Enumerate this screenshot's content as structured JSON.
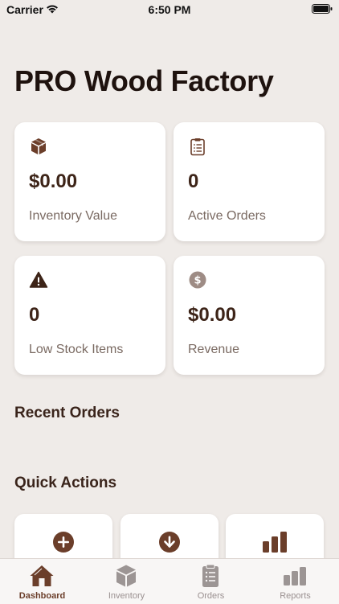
{
  "status_bar": {
    "carrier": "Carrier",
    "time": "6:50 PM"
  },
  "page": {
    "title": "PRO Wood Factory"
  },
  "stats": [
    {
      "icon": "box-icon",
      "value": "$0.00",
      "label": "Inventory Value"
    },
    {
      "icon": "clipboard-icon",
      "value": "0",
      "label": "Active Orders"
    },
    {
      "icon": "warning-icon",
      "value": "0",
      "label": "Low Stock Items"
    },
    {
      "icon": "dollar-icon",
      "value": "$0.00",
      "label": "Revenue"
    }
  ],
  "sections": {
    "recent_orders": "Recent Orders",
    "quick_actions": "Quick Actions"
  },
  "quick_actions": [
    {
      "icon": "add-circle-icon"
    },
    {
      "icon": "download-circle-icon"
    },
    {
      "icon": "bar-chart-icon"
    }
  ],
  "tabs": [
    {
      "label": "Dashboard",
      "icon": "house-icon",
      "active": true
    },
    {
      "label": "Inventory",
      "icon": "cube-icon",
      "active": false
    },
    {
      "label": "Orders",
      "icon": "list-clipboard-icon",
      "active": false
    },
    {
      "label": "Reports",
      "icon": "chart-icon",
      "active": false
    }
  ],
  "colors": {
    "background": "#EFEBE8",
    "accent": "#6B3E2A",
    "card": "#FFFFFF",
    "muted_text": "#7A6A62"
  }
}
